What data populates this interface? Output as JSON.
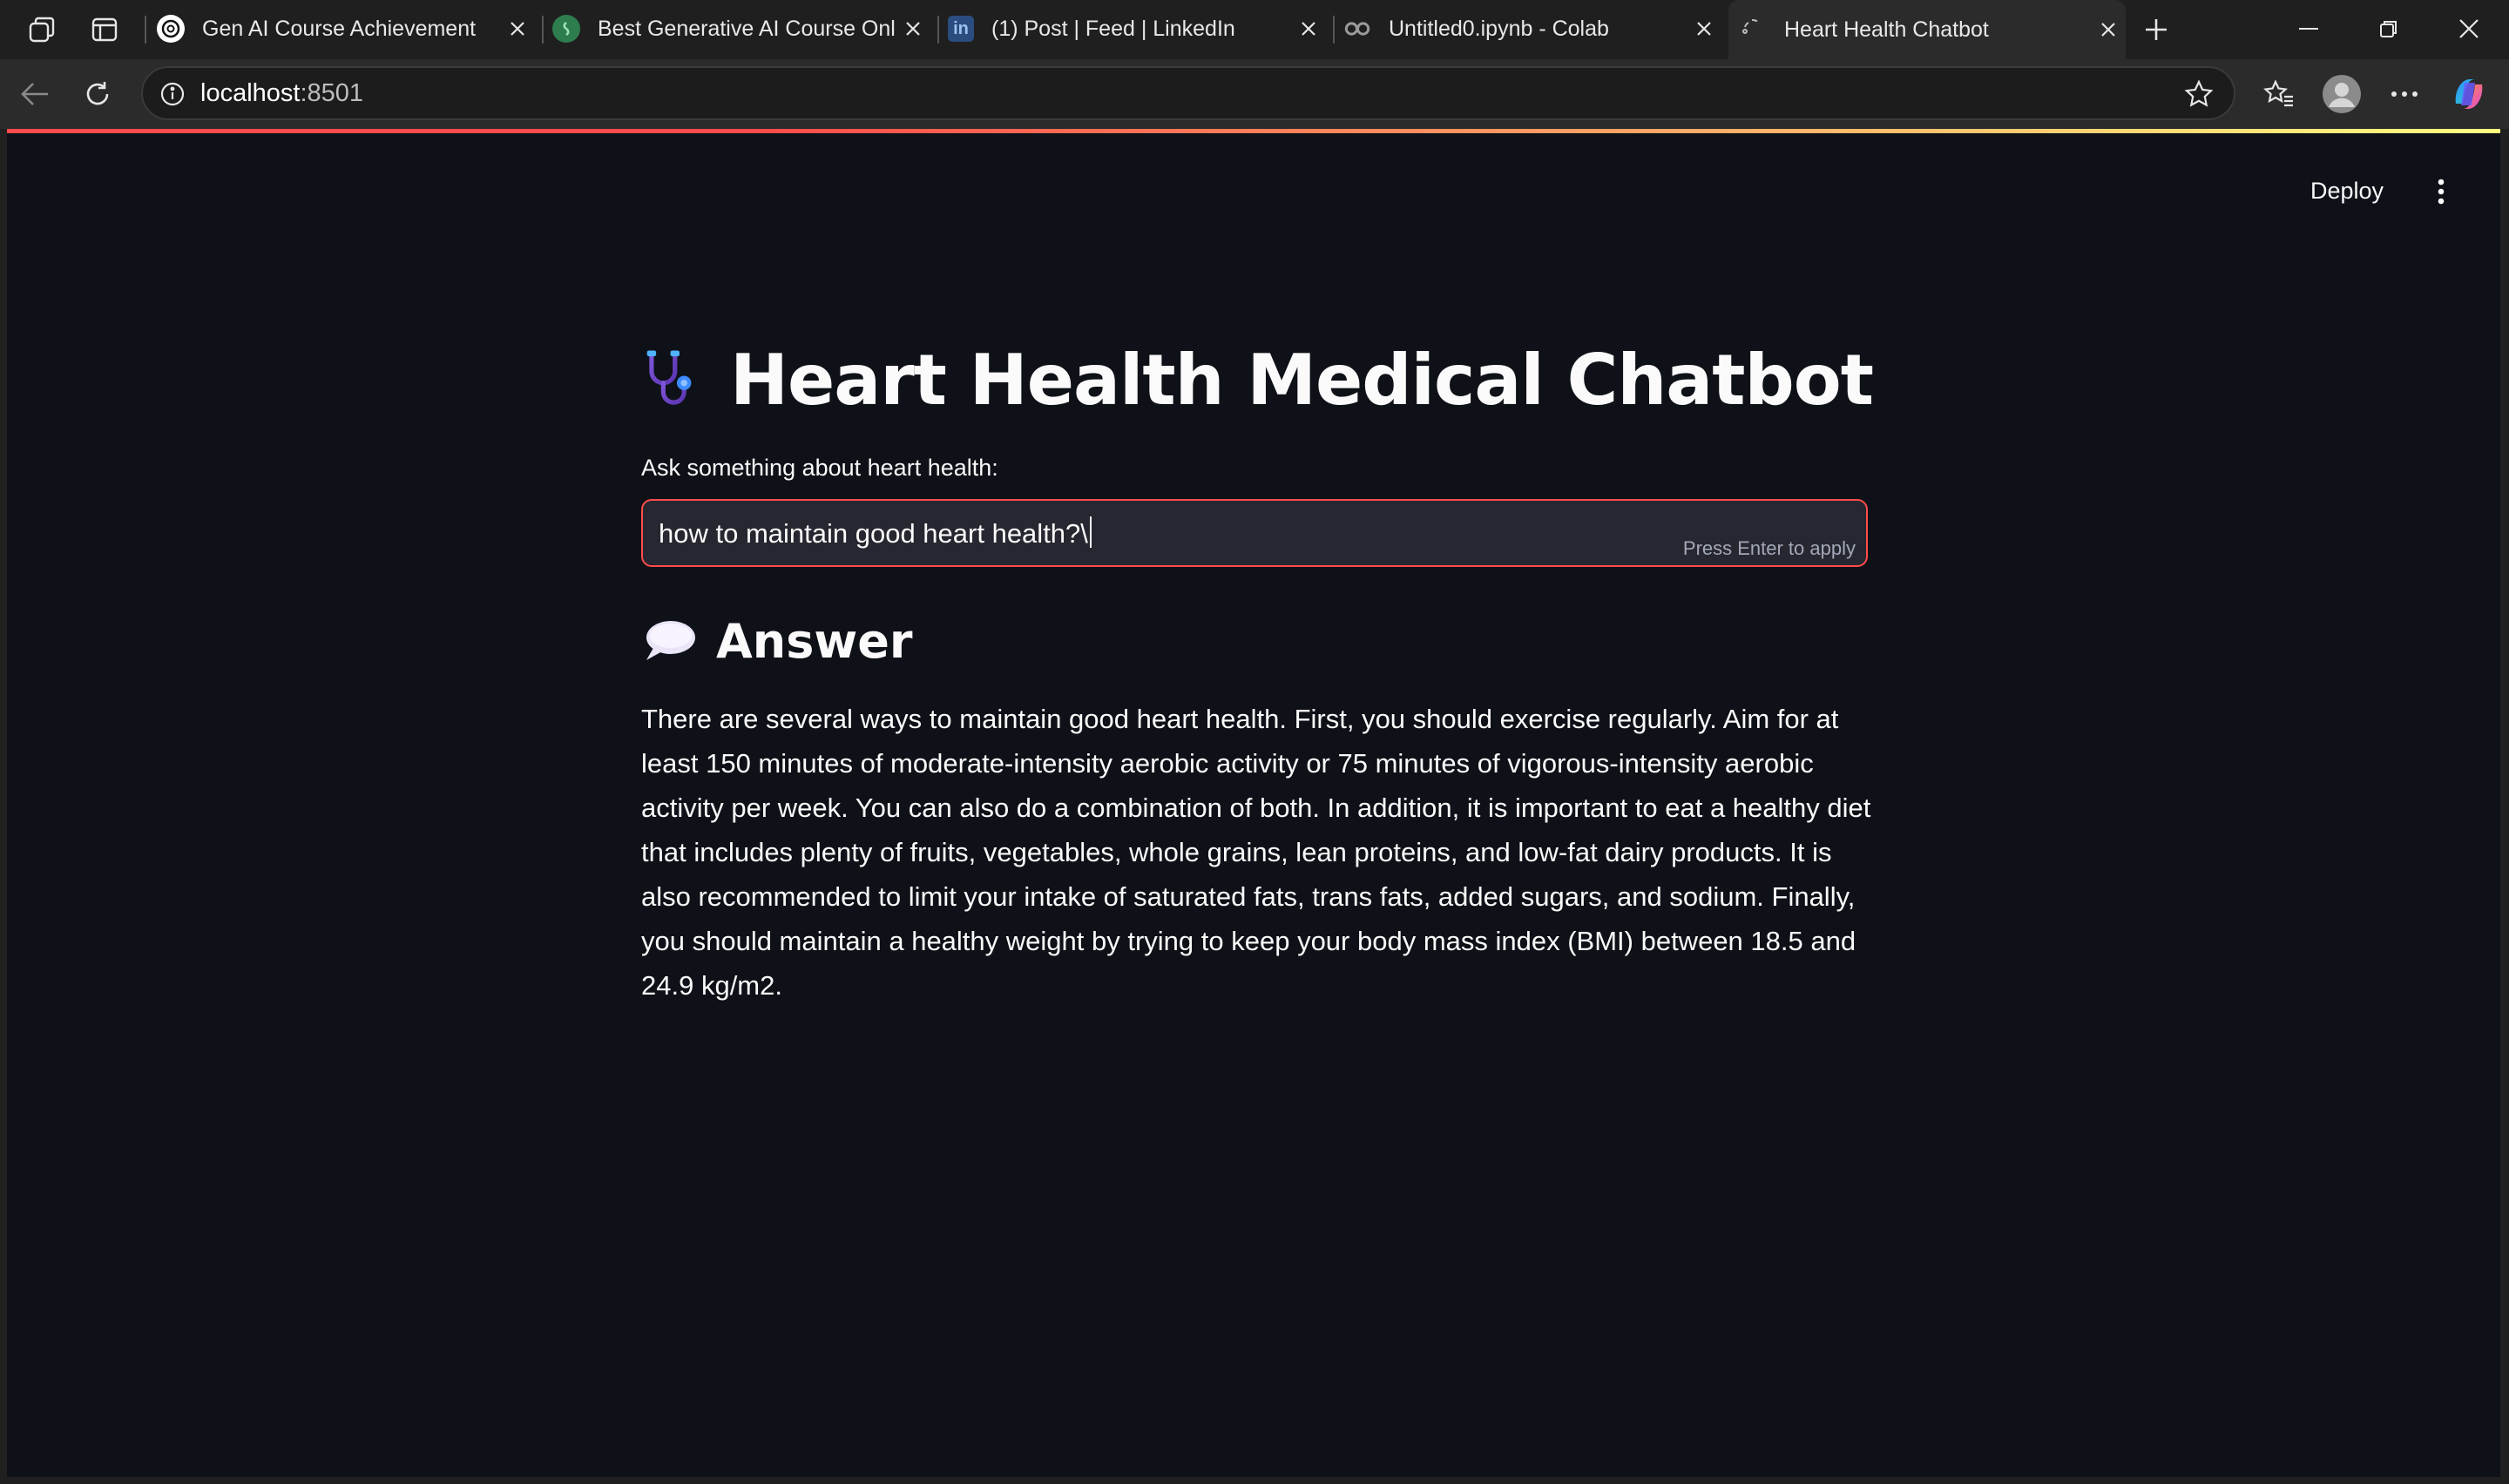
{
  "browser": {
    "tabs": [
      {
        "title": "Gen AI Course Achievement",
        "icon": "openai-icon",
        "active": false
      },
      {
        "title": "Best Generative AI Course Online",
        "icon": "course-site-icon",
        "active": false
      },
      {
        "title": "(1) Post | Feed | LinkedIn",
        "icon": "linkedin-icon",
        "active": false
      },
      {
        "title": "Untitled0.ipynb - Colab",
        "icon": "colab-icon",
        "active": false
      },
      {
        "title": "Heart Health Chatbot",
        "icon": "loading-icon",
        "active": true
      }
    ],
    "address": {
      "host": "localhost",
      "port": ":8501"
    }
  },
  "app": {
    "header": {
      "deploy_label": "Deploy"
    },
    "title": "Heart Health Medical Chatbot",
    "input": {
      "label": "Ask something about heart health:",
      "value": "how to maintain good heart health?\\",
      "hint": "Press Enter to apply"
    },
    "answer": {
      "heading": "Answer",
      "text": "There are several ways to maintain good heart health. First, you should exercise regularly. Aim for at least 150 minutes of moderate-intensity aerobic activity or 75 minutes of vigorous-intensity aerobic activity per week. You can also do a combination of both. In addition, it is important to eat a healthy diet that includes plenty of fruits, vegetables, whole grains, lean proteins, and low-fat dairy products. It is also recommended to limit your intake of saturated fats, trans fats, added sugars, and sodium. Finally, you should maintain a healthy weight by trying to keep your body mass index (BMI) between 18.5 and 24.9 kg/m2."
    }
  },
  "colors": {
    "app_background": "#0e1117",
    "input_background": "#262730",
    "accent": "#ff4b4b",
    "browser_chrome": "#202020"
  }
}
